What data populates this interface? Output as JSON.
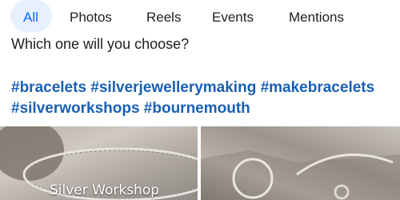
{
  "tabs": [
    {
      "label": "All",
      "active": true
    },
    {
      "label": "Photos",
      "active": false
    },
    {
      "label": "Reels",
      "active": false
    },
    {
      "label": "Events",
      "active": false
    },
    {
      "label": "Mentions",
      "active": false
    }
  ],
  "post": {
    "caption": "Which one will you choose?",
    "hashtags_line1": "#bracelets #silverjewellerymaking #makebracelets",
    "hashtags_line2": "#silverworkshops #bournemouth"
  },
  "photos": [
    {
      "label": "Silver Workshop"
    },
    {
      "label": ""
    }
  ],
  "colors": {
    "accent": "#0866ff",
    "hashtag": "#1a5fb4",
    "tab_active_bg": "#e7f0fe"
  }
}
